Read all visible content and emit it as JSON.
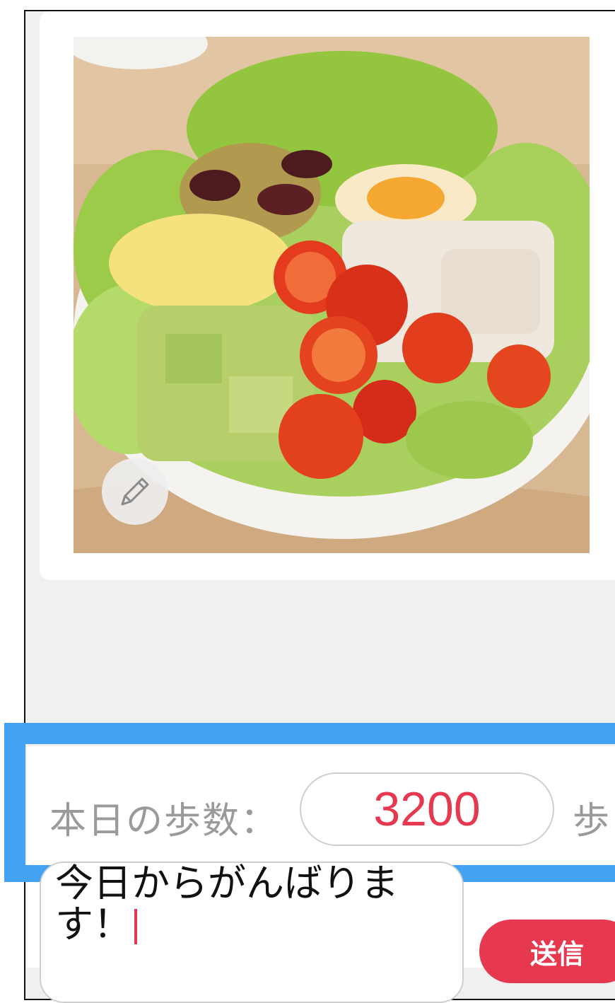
{
  "post": {
    "photo_alt": "salad-photo",
    "edit_icon": "pencil-icon"
  },
  "steps": {
    "label": "本日の歩数：",
    "value": "3200",
    "unit": "歩"
  },
  "comment": {
    "text": "今日からがんばりま\nす！"
  },
  "actions": {
    "send_label": "送信"
  },
  "colors": {
    "accent": "#e63950",
    "highlight": "#42a2f4",
    "background": "#f0f0f0"
  }
}
